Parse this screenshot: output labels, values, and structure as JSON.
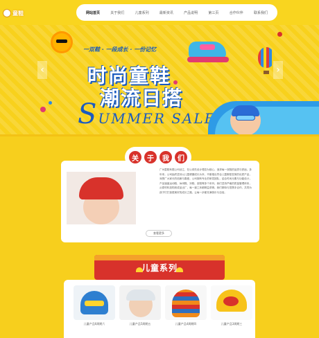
{
  "header": {
    "logo_text": "童鞋",
    "nav": [
      "网站首页",
      "关于我们",
      "儿童系列",
      "最新资讯",
      "产品说明",
      "第三页",
      "合作伙伴",
      "联系我们"
    ]
  },
  "banner": {
    "slogan": "一双鞋 · 一段成长 · 一份记忆",
    "title_line1": "时尚童鞋",
    "title_line2": "潮流日搭",
    "summer_first": "S",
    "summer_rest": "UMMER SALE",
    "prev_arrow": "‹",
    "next_arrow": "›"
  },
  "about": {
    "title_chars": [
      "关",
      "于",
      "我",
      "们"
    ],
    "text": "广州童鞋有限公司创立，在以领先设计理念为核心，追求每一双鞋的品质与舒适。多年来，公司始终坚持以儿童健康成长为本，不断推出符合儿童脚型发育的优质产品，深受广大家长的信赖与喜爱。公司拥有专业的研发团队，结合时尚元素与功能设计，产品涵盖运动鞋、休闲鞋、凉鞋、皮鞋等多个系列。我们坚持严格的质量管理体系，从原材料选购到成品出厂，每一道工序都精益求精。我们期待与您携手合作，共同为孩子们打造更美好的成长之路，让每一步都充满快乐与自信。",
    "more_button": "查看更多"
  },
  "series": {
    "title": "儿童系列",
    "products": [
      {
        "caption": "儿童产品6周期六"
      },
      {
        "caption": "儿童产品5周期五"
      },
      {
        "caption": "儿童产品4周期四"
      },
      {
        "caption": "儿童产品3周期三"
      }
    ]
  },
  "colors": {
    "background": "#f7cf1d",
    "accent_red": "#d8322b",
    "accent_blue": "#1b5bc0"
  }
}
